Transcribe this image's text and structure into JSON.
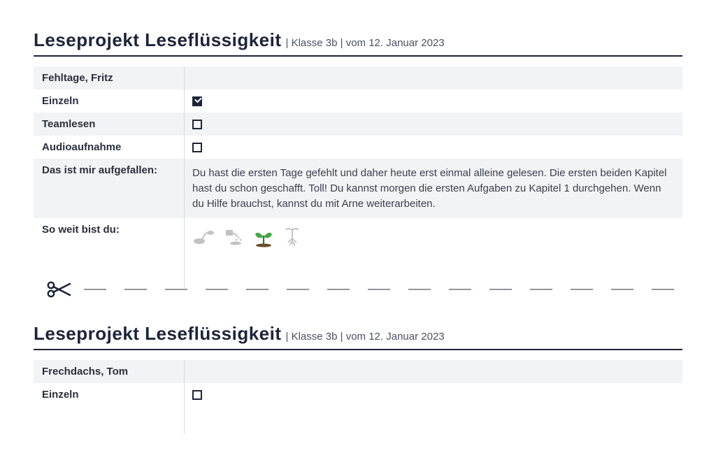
{
  "header": {
    "title": "Leseprojekt  Leseflüssigkeit",
    "meta": "| Klasse 3b | vom 12. Januar 2023"
  },
  "row_labels": {
    "einzeln": "Einzeln",
    "teamlesen": "Teamlesen",
    "audio": "Audioaufnahme",
    "notes": "Das ist mir aufgefallen:",
    "progress": "So weit bist du:"
  },
  "progress_stages": [
    "seed",
    "watering",
    "sprout",
    "roots"
  ],
  "students": [
    {
      "name": "Fehltage, Fritz",
      "einzeln": true,
      "teamlesen": false,
      "audio": false,
      "notes": "Du hast die ersten Tage gefehlt und daher heute erst einmal alleine gelesen. Die ersten beiden Kapitel hast du schon geschafft. Toll! Du kannst morgen die ersten Aufgaben zu Kapitel 1 durchgehen. Wenn du Hilfe brauchst, kannst du mit Arne weiterarbeiten.",
      "progress_stage": 2
    },
    {
      "name": "Frechdachs, Tom",
      "einzeln": false,
      "teamlesen": false,
      "audio": false,
      "notes": "",
      "progress_stage": 0
    }
  ]
}
